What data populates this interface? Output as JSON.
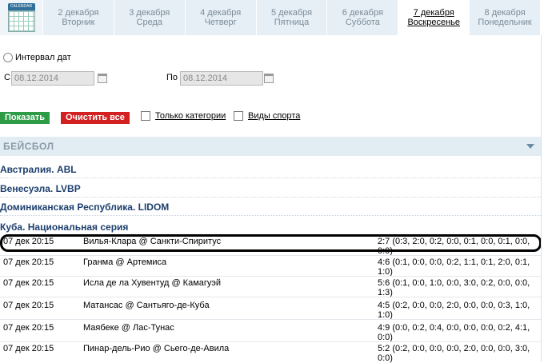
{
  "calendar": {
    "icon_label": "CALENDAR"
  },
  "tabs": [
    {
      "date": "2 декабря",
      "day": "Вторник"
    },
    {
      "date": "3 декабря",
      "day": "Среда"
    },
    {
      "date": "4 декабря",
      "day": "Четверг"
    },
    {
      "date": "5 декабря",
      "day": "Пятница"
    },
    {
      "date": "6 декабря",
      "day": "Суббота"
    },
    {
      "date": "7 декабря",
      "day": "Воскресенье"
    },
    {
      "date": "8 декабря",
      "day": "Понедельник"
    }
  ],
  "active_tab": 5,
  "interval": {
    "label": "Интервал дат",
    "from_label": "С",
    "from_value": "08.12.2014",
    "to_label": "По",
    "to_value": "08.12.2014"
  },
  "actions": {
    "show": "Показать",
    "clear": "Очистить все",
    "only_categories": "Только категории",
    "sports": "Виды спорта"
  },
  "section": {
    "title": "БЕЙСБОЛ"
  },
  "leagues": [
    "Австралия. ABL",
    "Венесуэла. LVBP",
    "Доминиканская Республика. LIDOM",
    "Куба. Национальная серия"
  ],
  "matches": [
    {
      "time": "07 дек 20:15",
      "teams": "Вилья-Клара @ Санкти-Спиритус",
      "score": "2:7 (0:3, 2:0, 0:2, 0:0, 0:1, 0:0, 0:1, 0:0, 0:0)"
    },
    {
      "time": "07 дек 20:15",
      "teams": "Гранма @ Артемиса",
      "score": "4:6 (0:1, 0:0, 0:0, 0:2, 1:1, 0:1, 2:0, 0:1, 1:0)"
    },
    {
      "time": "07 дек 20:15",
      "teams": "Исла де ла Хувентуд @ Камагуэй",
      "score": "5:6 (0:1, 0:0, 1:0, 0:0, 3:0, 0:2, 0:0, 0:0, 1:3)"
    },
    {
      "time": "07 дек 20:15",
      "teams": "Матансас @ Сантьяго-де-Куба",
      "score": "4:5 (0:2, 0:0, 0:0, 2:0, 0:0, 0:0, 0:3, 1:0, 1:0)"
    },
    {
      "time": "07 дек 20:15",
      "teams": "Маябеке @ Лас-Тунас",
      "score": "4:9 (0:0, 0:2, 0:4, 0:0, 0:0, 0:0, 0:2, 4:1, 0:0)"
    },
    {
      "time": "07 дек 20:15",
      "teams": "Пинар-дель-Рио @ Сьего-де-Авила",
      "score": "5:2 (0:2, 0:0, 0:0, 0:0, 2:0, 0:0, 0:0, 3:0, 0:0)"
    }
  ]
}
